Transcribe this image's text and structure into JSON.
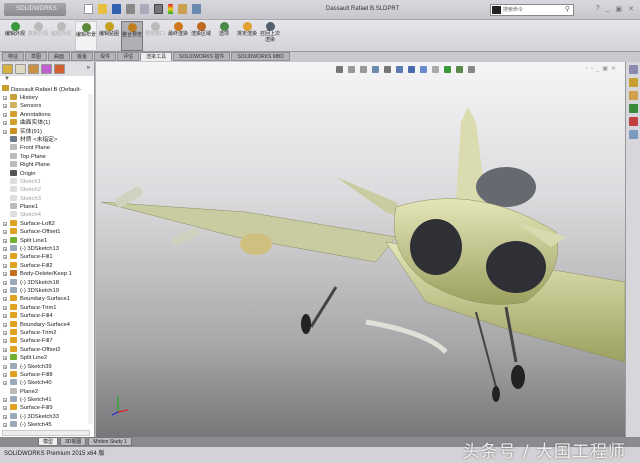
{
  "app": {
    "logo": "SOLIDWORKS",
    "title": "Dassault Rafael B.SLDPRT",
    "search_placeholder": "搜索命令"
  },
  "ribbon": [
    {
      "label": "编辑外观",
      "state": "normal",
      "color": "#3a9a3a"
    },
    {
      "label": "复制外观",
      "state": "disabled",
      "color": "#bbb"
    },
    {
      "label": "粘贴外观",
      "state": "disabled",
      "color": "#bbb"
    },
    {
      "label": "编辑布景",
      "state": "highlight",
      "color": "#5a8a3a"
    },
    {
      "label": "编辑贴图",
      "state": "normal",
      "color": "#c8a020"
    },
    {
      "label": "整合预览",
      "state": "selected",
      "color": "#c08020"
    },
    {
      "label": "预览窗口",
      "state": "disabled",
      "color": "#bbb"
    },
    {
      "label": "最终渲染",
      "state": "normal",
      "color": "#d07818"
    },
    {
      "label": "渲染区域",
      "state": "normal",
      "color": "#c06820"
    },
    {
      "label": "选项",
      "state": "normal",
      "color": "#4a8a4a"
    },
    {
      "label": "排定渲染",
      "state": "normal",
      "color": "#e0a030"
    },
    {
      "label": "召回上次渲染",
      "state": "normal",
      "color": "#506070"
    }
  ],
  "command_tabs": [
    "特征",
    "草图",
    "曲面",
    "钣金",
    "焊件",
    "评估",
    "渲染工具",
    "SOLIDWORKS 插件",
    "SOLIDWORKS MBD"
  ],
  "active_command_tab": "渲染工具",
  "tree": {
    "root": "Dassault Rafael B  (Default-",
    "items": [
      {
        "label": "History",
        "icon": "history-icon",
        "gray": false
      },
      {
        "label": "Sensors",
        "icon": "sensor-icon",
        "gray": false
      },
      {
        "label": "Annotations",
        "icon": "annotation-icon",
        "gray": false
      },
      {
        "label": "曲面实体(1)",
        "icon": "surface-bodies-icon",
        "gray": false
      },
      {
        "label": "实体(91)",
        "icon": "solid-bodies-icon",
        "gray": false
      },
      {
        "label": "材质 <未指定>",
        "icon": "material-icon",
        "gray": false
      },
      {
        "label": "Front Plane",
        "icon": "plane-icon",
        "gray": false
      },
      {
        "label": "Top Plane",
        "icon": "plane-icon",
        "gray": false
      },
      {
        "label": "Right Plane",
        "icon": "plane-icon",
        "gray": false
      },
      {
        "label": "Origin",
        "icon": "origin-icon",
        "gray": false
      },
      {
        "label": "Sketch1",
        "icon": "sketch-icon",
        "gray": true
      },
      {
        "label": "Sketch2",
        "icon": "sketch-icon",
        "gray": true
      },
      {
        "label": "Sketch3",
        "icon": "sketch-icon",
        "gray": true
      },
      {
        "label": "Plane1",
        "icon": "plane-icon",
        "gray": false
      },
      {
        "label": "Sketch4",
        "icon": "sketch-icon",
        "gray": true
      },
      {
        "label": "Surface-Loft2",
        "icon": "surface-icon",
        "gray": false
      },
      {
        "label": "Surface-Offset1",
        "icon": "surface-icon",
        "gray": false
      },
      {
        "label": "Split Line1",
        "icon": "split-line-icon",
        "gray": false
      },
      {
        "label": "(-) 3DSketch13",
        "icon": "sketch-icon",
        "gray": false
      },
      {
        "label": "Surface-Fill1",
        "icon": "surface-icon",
        "gray": false
      },
      {
        "label": "Surface-Fill2",
        "icon": "surface-icon",
        "gray": false
      },
      {
        "label": "Body-Delete/Keep 1",
        "icon": "body-delete-icon",
        "gray": false
      },
      {
        "label": "(-) 3DSketch18",
        "icon": "sketch-icon",
        "gray": false
      },
      {
        "label": "(-) 3DSketch19",
        "icon": "sketch-icon",
        "gray": false
      },
      {
        "label": "Boundary-Surface1",
        "icon": "surface-icon",
        "gray": false
      },
      {
        "label": "Surface-Trim1",
        "icon": "surface-icon",
        "gray": false
      },
      {
        "label": "Surface-Fill4",
        "icon": "surface-icon",
        "gray": false
      },
      {
        "label": "Boundary-Surface4",
        "icon": "surface-icon",
        "gray": false
      },
      {
        "label": "Surface-Trim2",
        "icon": "surface-icon",
        "gray": false
      },
      {
        "label": "Surface-Fill7",
        "icon": "surface-icon",
        "gray": false
      },
      {
        "label": "Surface-Offset2",
        "icon": "surface-icon",
        "gray": false
      },
      {
        "label": "Split Line2",
        "icon": "split-line-icon",
        "gray": false
      },
      {
        "label": "(-) Sketch39",
        "icon": "sketch-icon",
        "gray": false
      },
      {
        "label": "Surface-Fill8",
        "icon": "surface-icon",
        "gray": false
      },
      {
        "label": "(-) Sketch40",
        "icon": "sketch-icon",
        "gray": false
      },
      {
        "label": "Plane2",
        "icon": "plane-icon",
        "gray": false
      },
      {
        "label": "(-) Sketch41",
        "icon": "sketch-icon",
        "gray": false
      },
      {
        "label": "Surface-Fill9",
        "icon": "surface-icon",
        "gray": false
      },
      {
        "label": "(-) 3DSketch33",
        "icon": "sketch-icon",
        "gray": false
      },
      {
        "label": "(-) Sketch45",
        "icon": "sketch-icon",
        "gray": false
      }
    ]
  },
  "bottom_tabs": [
    "模型",
    "3D视图",
    "Motion Study 1"
  ],
  "status": "SOLIDWORKS Premium 2015 x64 版",
  "watermark": "头条号 / 大国工程师"
}
